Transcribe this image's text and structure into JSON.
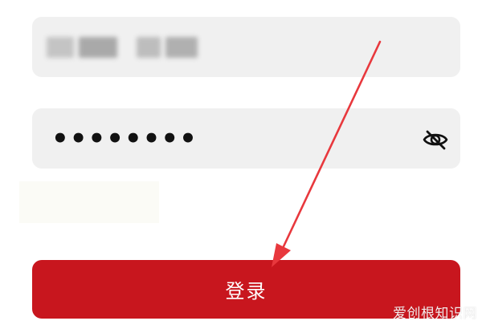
{
  "login_form": {
    "account_field": {
      "masked": true
    },
    "password_field": {
      "value": "••••••••",
      "visibility_icon": "eye-slash-icon"
    },
    "login_button": {
      "label": "登录"
    }
  },
  "annotation": {
    "arrow_color": "#e8383d"
  },
  "watermark": {
    "text": "爱创根知识网"
  },
  "colors": {
    "field_background": "#f0f0f0",
    "button_background": "#c8161e",
    "button_text": "#ffffff"
  }
}
